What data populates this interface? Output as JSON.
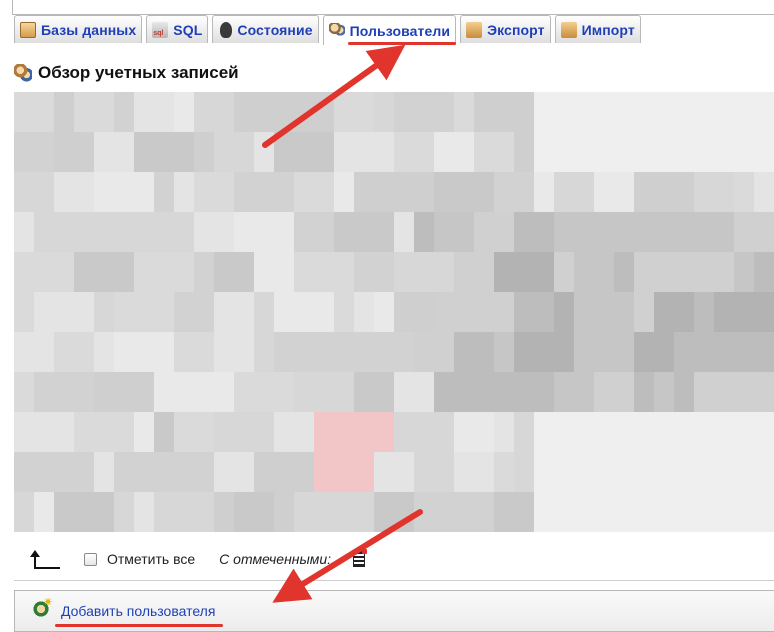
{
  "tabs": [
    {
      "label": "Базы данных",
      "icon": "database-icon"
    },
    {
      "label": "SQL",
      "icon": "sql-icon"
    },
    {
      "label": "Состояние",
      "icon": "status-icon"
    },
    {
      "label": "Пользователи",
      "icon": "users-icon",
      "active": true
    },
    {
      "label": "Экспорт",
      "icon": "export-icon"
    },
    {
      "label": "Импорт",
      "icon": "import-icon"
    }
  ],
  "header": {
    "title": "Обзор учетных записей",
    "icon": "users-overview-icon"
  },
  "table": {
    "blurred": true
  },
  "bulk": {
    "check_all": "Отметить все",
    "with_selected": "С отмеченными:"
  },
  "add_user": {
    "label": "Добавить пользователя",
    "icon": "add-user-icon"
  },
  "colors": {
    "tab_text": "#1f3fb8",
    "highlight": "#e0342c",
    "annotation_arrow": "#e0342c"
  }
}
